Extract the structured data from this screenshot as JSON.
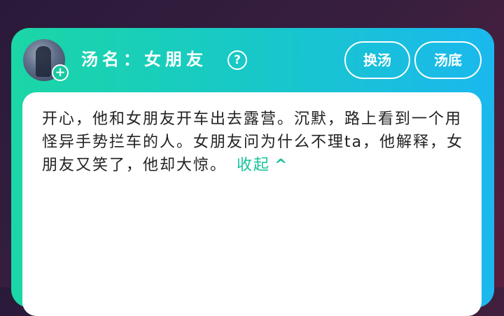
{
  "header": {
    "title": "汤名：女朋友",
    "help_icon": "question-circle-icon",
    "avatar_add_icon": "+",
    "buttons": {
      "change": "换汤",
      "bottom": "汤底"
    }
  },
  "story": {
    "text": "开心，他和女朋友开车出去露营。沉默，路上看到一个用怪异手势拦车的人。女朋友问为什么不理ta，他解释，女朋友又笑了，他却大惊。",
    "collapse_label": "收起",
    "collapse_icon": "chevron-up-icon"
  },
  "colors": {
    "accent": "#16c39c",
    "header_gradient_start": "#1bd6a6",
    "header_gradient_end": "#1ab8ee",
    "background": "#2a1a3a"
  }
}
